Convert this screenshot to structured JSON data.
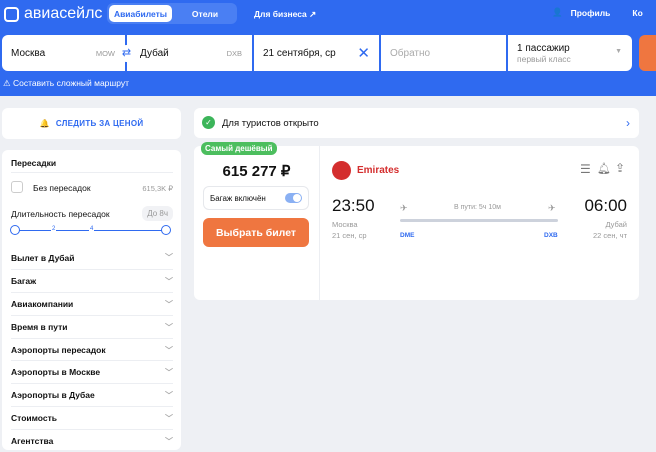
{
  "header": {
    "logo": "авиасейлс",
    "tabs": [
      "Авиабилеты",
      "Отели"
    ],
    "business": "Для бизнеса ↗",
    "profile": "Профиль",
    "extra": "Ко"
  },
  "search": {
    "from": "Москва",
    "from_code": "MOW",
    "to": "Дубай",
    "to_code": "DXB",
    "date": "21 сентября, ср",
    "return_placeholder": "Обратно",
    "passengers": "1 пассажир",
    "class": "первый класс",
    "complex_route": "Составить сложный маршрут"
  },
  "sidebar": {
    "subscribe": "СЛЕДИТЬ ЗА ЦЕНОЙ",
    "transfers_title": "Пересадки",
    "no_transfers": "Без пересадок",
    "no_transfers_price": "615,3K ₽",
    "duration_label": "Длительность пересадок",
    "duration_value": "До 8ч",
    "slider_ticks": [
      "2",
      "4"
    ],
    "filters": [
      "Вылет в Дубай",
      "Багаж",
      "Авиакомпании",
      "Время в пути",
      "Аэропорты пересадок",
      "Аэропорты в Москве",
      "Аэропорты в Дубае",
      "Стоимость",
      "Агентства"
    ]
  },
  "banner": {
    "text": "Для туристов открыто"
  },
  "ticket": {
    "badge": "Самый дешёвый",
    "price": "615 277 ₽",
    "baggage": "Багаж включён",
    "baggage_on": true,
    "buy": "Выбрать билет",
    "airline": "Emirates",
    "dep_time": "23:50",
    "dep_city": "Москва",
    "dep_date": "21 сен, ср",
    "duration": "В пути: 5ч 10м",
    "dep_airport": "DME",
    "arr_airport": "DXB",
    "arr_time": "06:00",
    "arr_city": "Дубай",
    "arr_date": "22 сен, чт"
  }
}
